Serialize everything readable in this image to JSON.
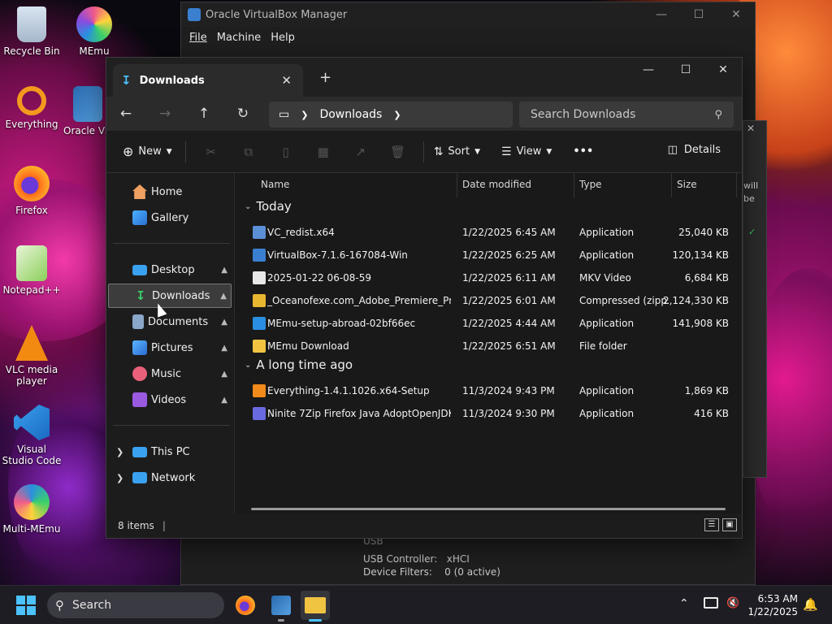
{
  "desktop": {
    "icons": [
      {
        "label": "Recycle Bin"
      },
      {
        "label": "MEmu"
      },
      {
        "label": "Everything"
      },
      {
        "label": "Oracle VirtualBox"
      },
      {
        "label": "Firefox"
      },
      {
        "label": "Notepad++"
      },
      {
        "label": "VLC media player"
      },
      {
        "label": "Visual Studio Code"
      },
      {
        "label": "Multi-MEmu"
      }
    ]
  },
  "vbox": {
    "title": "Oracle VirtualBox Manager",
    "menu": [
      "File",
      "Machine",
      "Help"
    ],
    "usb": {
      "heading": "USB",
      "controller_label": "USB Controller:",
      "controller_value": "xHCI",
      "filters_label": "Device Filters:",
      "filters_value": "0 (0 active)"
    },
    "side_text": "will be"
  },
  "explorer": {
    "tab_title": "Downloads",
    "breadcrumb": "Downloads",
    "search_placeholder": "Search Downloads",
    "commands": {
      "new": "New",
      "sort": "Sort",
      "view": "View",
      "more": "•••",
      "details": "Details"
    },
    "nav": {
      "home": "Home",
      "gallery": "Gallery",
      "desktop": "Desktop",
      "downloads": "Downloads",
      "documents": "Documents",
      "pictures": "Pictures",
      "music": "Music",
      "videos": "Videos",
      "thispc": "This PC",
      "network": "Network"
    },
    "columns": {
      "name": "Name",
      "date": "Date modified",
      "type": "Type",
      "size": "Size"
    },
    "groups": [
      {
        "label": "Today",
        "files": [
          {
            "name": "VC_redist.x64",
            "date": "1/22/2025 6:45 AM",
            "type": "Application",
            "size": "25,040 KB",
            "icon": "installer-icon",
            "color": "#5b8fd6"
          },
          {
            "name": "VirtualBox-7.1.6-167084-Win",
            "date": "1/22/2025 6:25 AM",
            "type": "Application",
            "size": "120,134 KB",
            "icon": "virtualbox-icon",
            "color": "#3a7fd0"
          },
          {
            "name": "2025-01-22 06-08-59",
            "date": "1/22/2025 6:11 AM",
            "type": "MKV Video",
            "size": "6,684 KB",
            "icon": "video-file-icon",
            "color": "#e8e8e8"
          },
          {
            "name": "_Oceanofexe.com_Adobe_Premiere_Pro_...",
            "date": "1/22/2025 6:01 AM",
            "type": "Compressed (zipp...",
            "size": "2,124,330 KB",
            "icon": "zip-folder-icon",
            "color": "#e8b730"
          },
          {
            "name": "MEmu-setup-abroad-02bf66ec",
            "date": "1/22/2025 4:44 AM",
            "type": "Application",
            "size": "141,908 KB",
            "icon": "memu-icon",
            "color": "#2a8fe0"
          },
          {
            "name": "MEmu Download",
            "date": "1/22/2025 6:51 AM",
            "type": "File folder",
            "size": "",
            "icon": "folder-icon",
            "color": "#f0c341"
          }
        ]
      },
      {
        "label": "A long time ago",
        "files": [
          {
            "name": "Everything-1.4.1.1026.x64-Setup",
            "date": "11/3/2024 9:43 PM",
            "type": "Application",
            "size": "1,869 KB",
            "icon": "everything-icon",
            "color": "#f08a1a"
          },
          {
            "name": "Ninite 7Zip Firefox Java AdoptOpenJDK x...",
            "date": "11/3/2024 9:30 PM",
            "type": "Application",
            "size": "416 KB",
            "icon": "ninite-icon",
            "color": "#6a6ae0"
          }
        ]
      }
    ],
    "status": "8 items"
  },
  "taskbar": {
    "search": "Search",
    "time": "6:53 AM",
    "date": "1/22/2025"
  },
  "colors": {
    "accent": "#4cc2ff",
    "folder": "#f0c341",
    "selected": "#3c3c3c"
  }
}
